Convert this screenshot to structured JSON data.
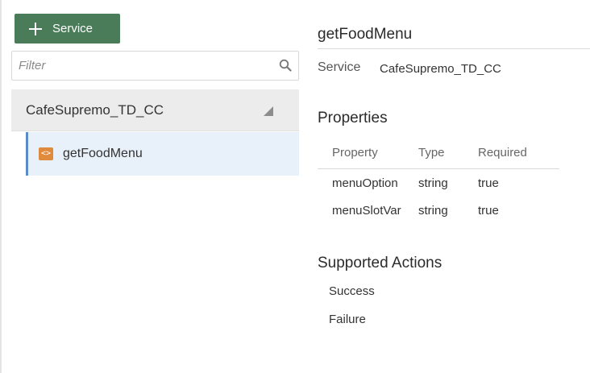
{
  "sidebar": {
    "add_button_label": "Service",
    "filter_placeholder": "Filter",
    "service": {
      "name": "CafeSupremo_TD_CC",
      "components": [
        {
          "label": "getFoodMenu"
        }
      ]
    }
  },
  "detail": {
    "title": "getFoodMenu",
    "service_label": "Service",
    "service_value": "CafeSupremo_TD_CC",
    "properties_heading": "Properties",
    "properties_columns": [
      "Property",
      "Type",
      "Required"
    ],
    "properties_rows": [
      {
        "property": "menuOption",
        "type": "string",
        "required": "true"
      },
      {
        "property": "menuSlotVar",
        "type": "string",
        "required": "true"
      }
    ],
    "actions_heading": "Supported Actions",
    "actions": [
      "Success",
      "Failure"
    ]
  },
  "colors": {
    "primary_button": "#4a7c59",
    "selected_row_bg": "#e8f0fa",
    "selected_row_accent": "#5b8cc9",
    "component_icon": "#e08a3c"
  },
  "icons": {
    "add": "plus-icon",
    "filter": "search-icon",
    "expand": "triangle-caret-icon",
    "component": "code-brackets-icon"
  }
}
